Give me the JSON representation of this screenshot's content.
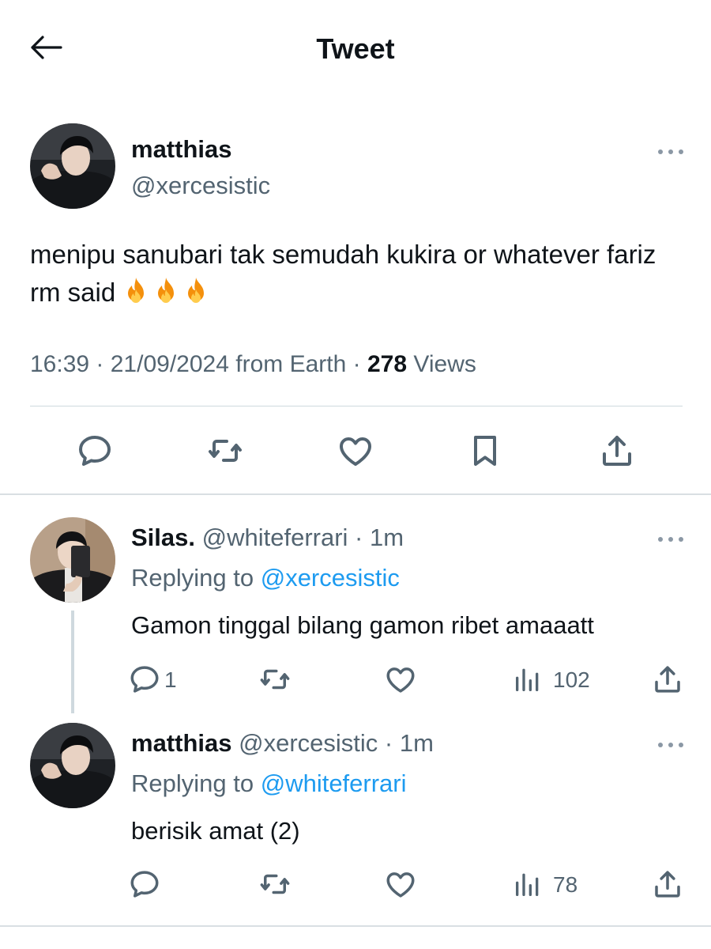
{
  "header": {
    "title": "Tweet",
    "back_icon": "arrow-left-icon"
  },
  "main_tweet": {
    "display_name": "matthias",
    "handle": "@xercesistic",
    "text": "menipu sanubari tak semudah kukira or whatever fariz rm said",
    "emoji": [
      "fire",
      "fire",
      "fire"
    ],
    "time": "16:39",
    "date": "21/09/2024",
    "source": "from Earth",
    "views_count": "278",
    "views_label": "Views",
    "actions": [
      "reply-icon",
      "retweet-icon",
      "like-icon",
      "bookmark-icon",
      "share-icon"
    ]
  },
  "replies": [
    {
      "display_name": "Silas.",
      "handle": "@whiteferrari",
      "time": "1m",
      "replying_label": "Replying to",
      "replying_to": "@xercesistic",
      "text": "Gamon tinggal bilang gamon ribet amaaatt",
      "reply_count": "1",
      "views": "102"
    },
    {
      "display_name": "matthias",
      "handle": "@xercesistic",
      "time": "1m",
      "replying_label": "Replying to",
      "replying_to": "@whiteferrari",
      "text": "berisik amat (2)",
      "views": "78"
    }
  ],
  "colors": {
    "link": "#1d9bf0",
    "secondary_text": "#536471",
    "divider": "#cfd9de"
  }
}
